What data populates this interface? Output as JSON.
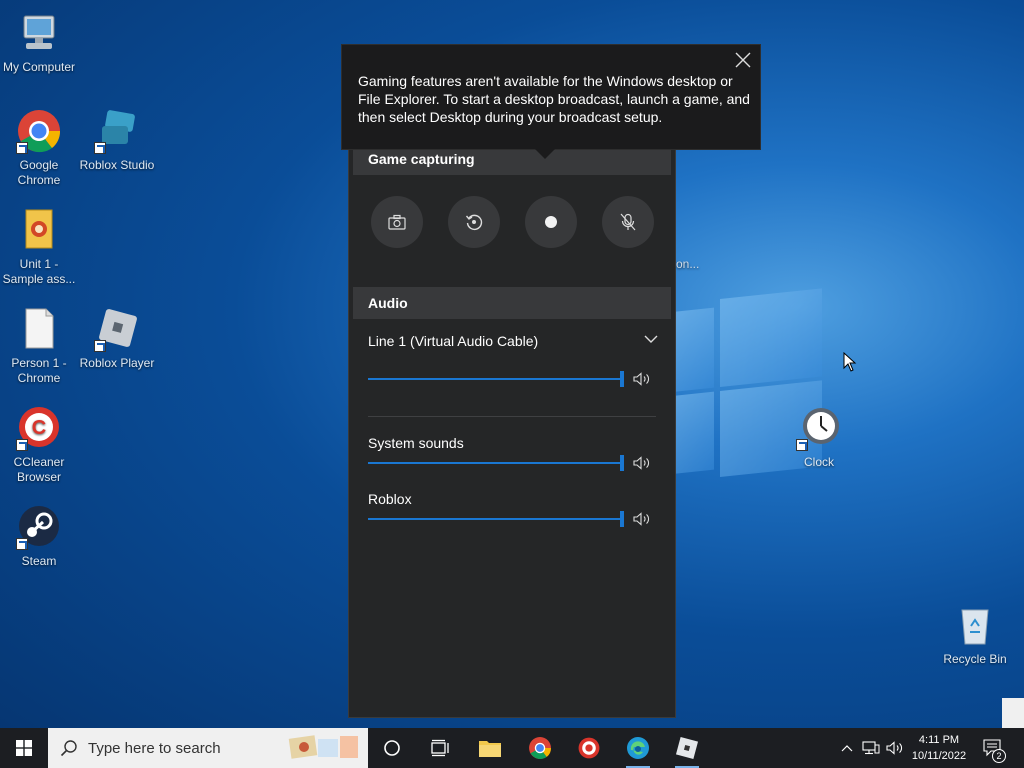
{
  "desktop": {
    "icons": [
      {
        "label": "My Computer"
      },
      {
        "label": "Google Chrome"
      },
      {
        "label": "Roblox Studio"
      },
      {
        "label": "Unit 1 - Sample ass..."
      },
      {
        "label": "Person 1 - Chrome"
      },
      {
        "label": "Roblox Player"
      },
      {
        "label": "CCleaner Browser"
      },
      {
        "label": "Steam"
      },
      {
        "label": "Clock"
      },
      {
        "label": "Recycle Bin"
      }
    ],
    "partial_label": "on..."
  },
  "tooltip": {
    "text": "Gaming features aren't available for the Windows desktop or File Explorer. To start a desktop broadcast, launch a game, and then select Desktop during your broadcast setup.",
    "close_icon": "close-icon"
  },
  "gamebar": {
    "capture_header": "Game capturing",
    "capture_buttons": [
      {
        "icon": "camera-icon"
      },
      {
        "icon": "replay-icon"
      },
      {
        "icon": "record-icon"
      },
      {
        "icon": "mic-off-icon"
      }
    ],
    "audio_header": "Audio",
    "device": "Line 1 (Virtual Audio Cable)",
    "sources": [
      {
        "label": "System sounds",
        "volume": 100
      },
      {
        "label": "Roblox",
        "volume": 100
      }
    ],
    "device_volume": 100,
    "accent": "#1a77d2"
  },
  "taskbar": {
    "search_placeholder": "Type here to search",
    "time": "4:11 PM",
    "date": "10/11/2022",
    "notification_count": "2"
  }
}
